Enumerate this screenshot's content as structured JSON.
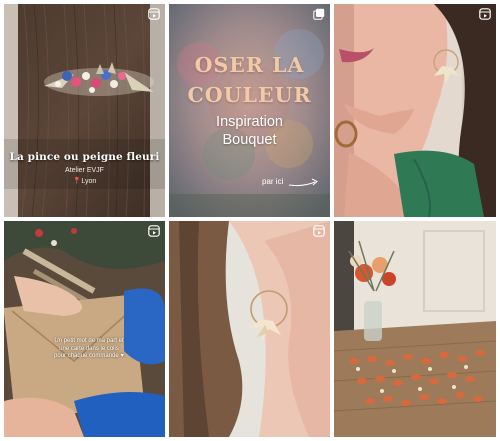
{
  "grid": {
    "tiles": [
      {
        "badge": "reel-icon",
        "title": "La pince ou peigne fleuri",
        "subtitle": "Atelier EVJF",
        "location": "Lyon"
      },
      {
        "badge": "multiple-images-icon",
        "title_line1": "OSER LA",
        "title_line2": "COULEUR",
        "subtitle_line1": "Inspiration",
        "subtitle_line2": "Bouquet",
        "cta": "par ici"
      },
      {
        "badge": "reel-icon"
      },
      {
        "badge": "reel-icon",
        "overlay_line1": "Un petit mot de ma part et",
        "overlay_line2": "une carte dans le colis",
        "overlay_line3": "pour chaque commande ♥"
      },
      {
        "badge": "reel-icon"
      },
      {
        "badge": ""
      }
    ]
  },
  "colors": {
    "title_peach": "#f4c9a8",
    "pin_red": "#e23b3b"
  }
}
